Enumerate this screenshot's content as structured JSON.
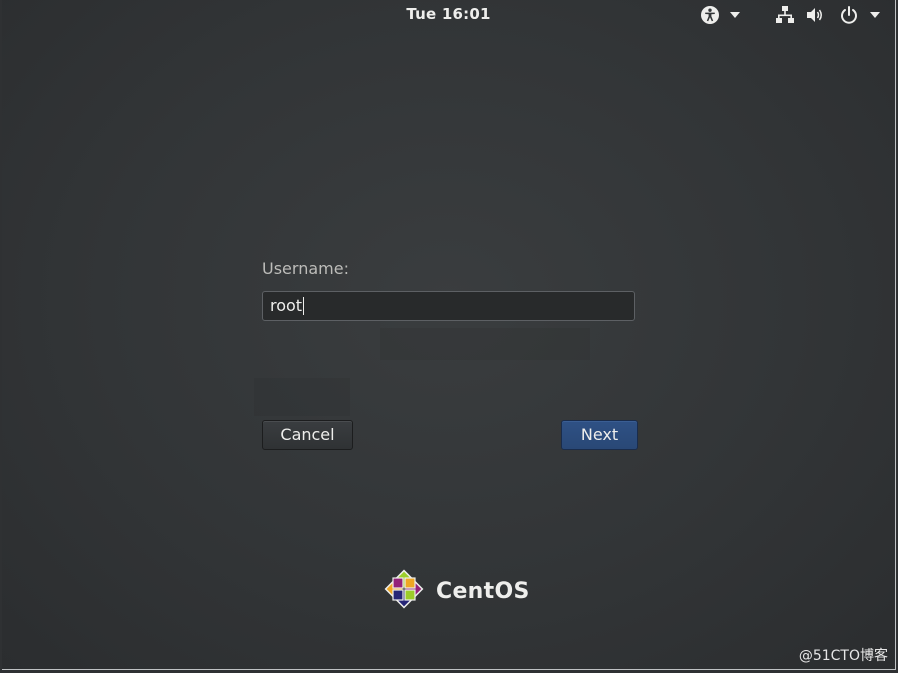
{
  "topbar": {
    "clock": "Tue 16:01",
    "icons": [
      "accessibility-icon",
      "dropdown-arrow-icon",
      "network-icon",
      "volume-icon",
      "power-icon",
      "dropdown-arrow-icon"
    ]
  },
  "login": {
    "username_label": "Username:",
    "username_value": "root",
    "cancel_label": "Cancel",
    "next_label": "Next"
  },
  "brand": {
    "logo_text": "CentOS"
  },
  "watermark": "@51CTO博客",
  "colors": {
    "background": "#323537",
    "next_button": "#2c4c7d",
    "text": "#eeeeec",
    "label": "#bcbcb9"
  }
}
